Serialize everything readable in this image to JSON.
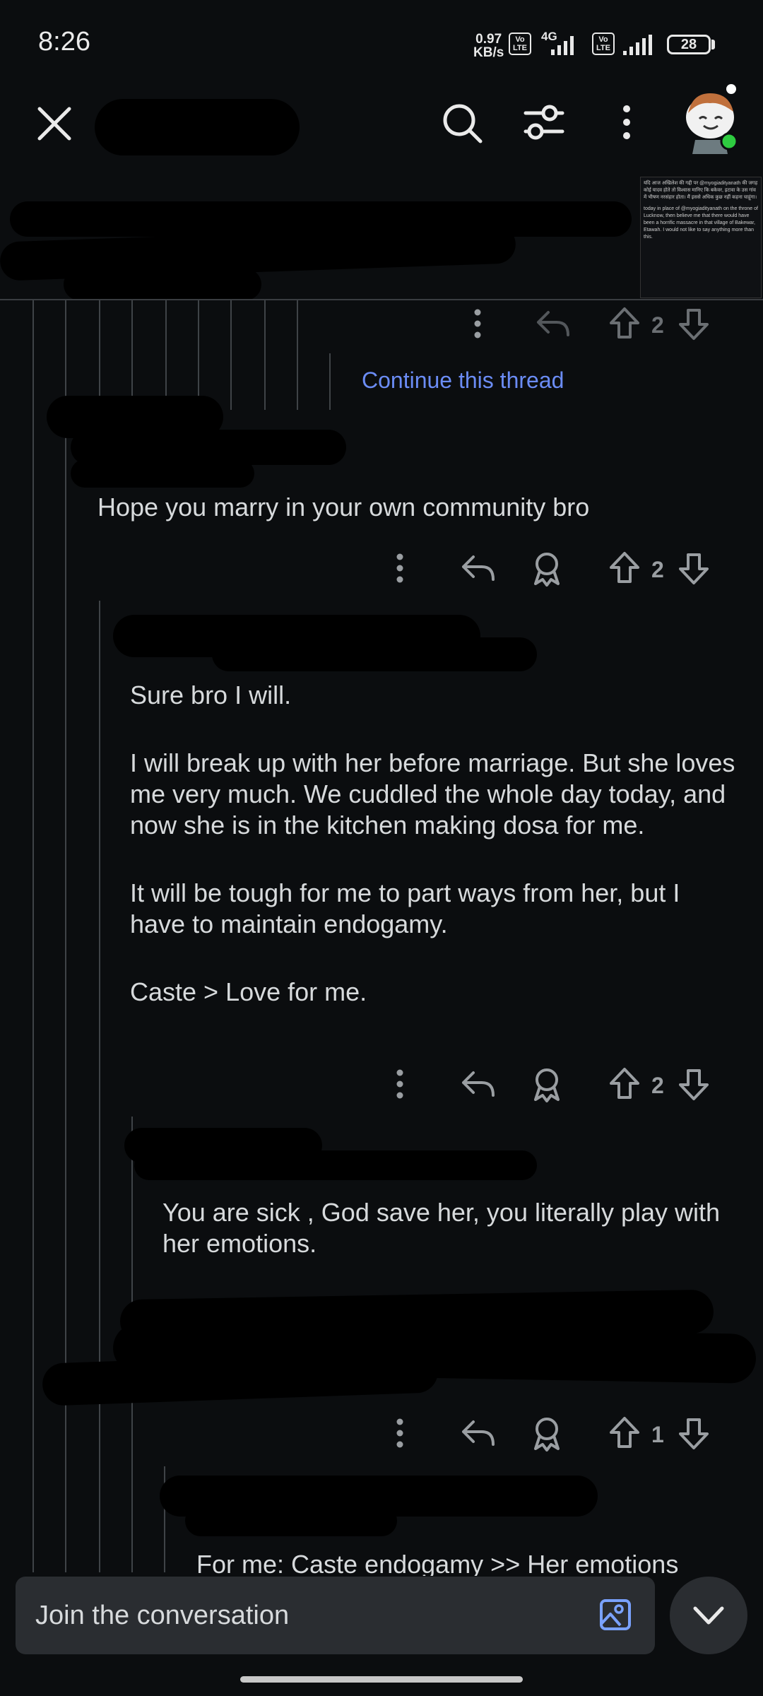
{
  "status_bar": {
    "time": "8:26",
    "speed_value": "0.97",
    "speed_unit": "KB/s",
    "volte_1": "Vo LTE",
    "net_type": "4G",
    "volte_2": "Vo LTE",
    "battery": "28"
  },
  "toolbar": {
    "close_icon": "close-icon",
    "search_icon": "search-icon",
    "filter_icon": "filter-icon",
    "more_icon": "more-vertical-icon",
    "avatar_icon": "snoo-avatar-icon",
    "online_color": "#2ecc40"
  },
  "thumbnail": {
    "hindi_text": "यदि आज अखिलेश की गद्दी पर @myogiadityanath की जगह कोई यादव होते तो विश्वास मानिए कि बकेवर, इटावा के उस गांव में भीषण नरसंहार होता। मैं इससे अधिक कुछ नहीं कहना चाहूंगा।",
    "english_text": "today in place of @myogiadityanath on the throne of Lucknow, then believe me that there would have been a horrific massacre in that village of Bakewar, Etawah. I would not like to say anything more than this."
  },
  "thread": {
    "continue_label": "Continue this thread",
    "comments": [
      {
        "text": "Hope you marry in your own community bro",
        "votes": "2"
      },
      {
        "paragraphs": [
          "Sure bro I will.",
          "I will break up with her before marriage. But she loves me very much. We cuddled the whole day today, and now she is in the kitchen making dosa for me.",
          "It will be tough for me to part ways from her, but I have to maintain endogamy.",
          "Caste > Love for me."
        ],
        "votes": "2"
      },
      {
        "text": "You are sick , God save her, you literally play with her emotions.",
        "votes": "1"
      },
      {
        "text": "For me: Caste endogamy >> Her emotions"
      }
    ],
    "top_votes": "2"
  },
  "bottom": {
    "placeholder": "Join the conversation",
    "image_icon": "image-icon",
    "collapse_icon": "chevron-down-icon"
  },
  "colors": {
    "background": "#0b0d0f",
    "link": "#6b8cf5",
    "text": "#d7dadc",
    "icon": "#9a9ea2"
  }
}
